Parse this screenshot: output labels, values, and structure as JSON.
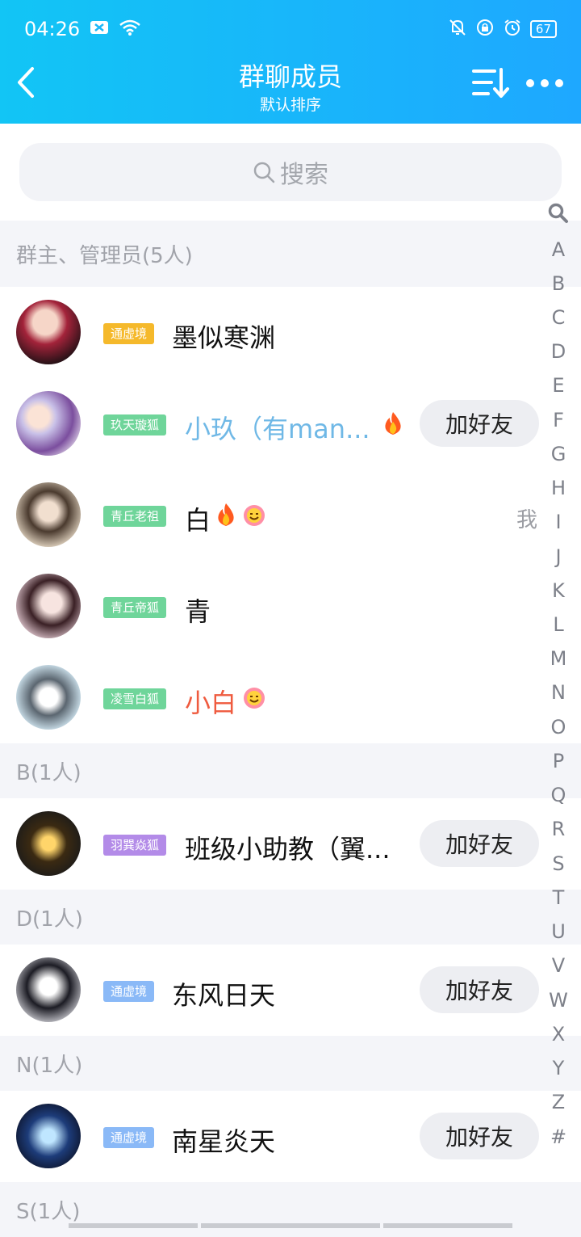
{
  "status_bar": {
    "time": "04:26",
    "battery": "67"
  },
  "header": {
    "title": "群聊成员",
    "subtitle": "默认排序"
  },
  "search": {
    "placeholder": "搜索"
  },
  "sections": [
    {
      "title": "群主、管理员(5人)"
    },
    {
      "title": "B(1人)"
    },
    {
      "title": "D(1人)"
    },
    {
      "title": "N(1人)"
    },
    {
      "title": "S(1人)"
    }
  ],
  "members": [
    {
      "badge": "通虚境",
      "name": "墨似寒渊",
      "action": ""
    },
    {
      "badge": "玖天璇狐",
      "name": "小玖（有man...",
      "action": "加好友"
    },
    {
      "badge": "青丘老祖",
      "name": "白",
      "action": "",
      "tag": "我"
    },
    {
      "badge": "青丘帝狐",
      "name": "青",
      "action": ""
    },
    {
      "badge": "凌雪白狐",
      "name": "小白",
      "action": ""
    },
    {
      "badge": "羽巽焱狐",
      "name": "班级小助教（翼...",
      "action": "加好友"
    },
    {
      "badge": "通虚境",
      "name": "东风日天",
      "action": "加好友"
    },
    {
      "badge": "通虚境",
      "name": "南星炎天",
      "action": "加好友"
    }
  ],
  "index_letters": [
    "A",
    "B",
    "C",
    "D",
    "E",
    "F",
    "G",
    "H",
    "I",
    "J",
    "K",
    "L",
    "M",
    "N",
    "O",
    "P",
    "Q",
    "R",
    "S",
    "T",
    "U",
    "V",
    "W",
    "X",
    "Y",
    "Z",
    "#"
  ],
  "colors": {
    "header_start": "#12c5f5",
    "header_end": "#1ea8ff",
    "badge_gold": "#f5b92b",
    "badge_green": "#6fd59a",
    "badge_purple": "#b38be8",
    "badge_blue": "#8ab9f7",
    "name_red": "#ef5b3f"
  },
  "icons": [
    "back-arrow-icon",
    "sort-icon",
    "more-icon",
    "search-icon",
    "fire-icon",
    "smile-face-icon"
  ]
}
